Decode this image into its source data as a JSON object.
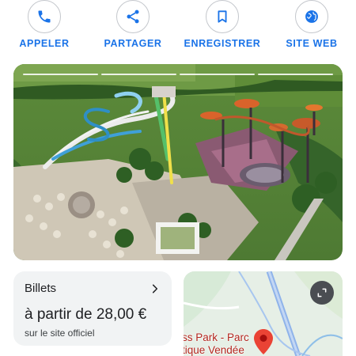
{
  "actions": [
    {
      "label": "APPELER",
      "icon": "phone-icon"
    },
    {
      "label": "PARTAGER",
      "icon": "share-icon"
    },
    {
      "label": "ENREGISTRER",
      "icon": "bookmark-icon"
    },
    {
      "label": "SITE WEB",
      "icon": "globe-icon"
    }
  ],
  "colors": {
    "accent": "#1a73e8",
    "pin": "#ea4335",
    "map_road": "#7aa8e8"
  },
  "hero": {
    "image": "aerial-water-park-photo",
    "story_segments": 4
  },
  "tickets": {
    "title": "Billets",
    "price": "à partir de 28,00 €",
    "source": "sur le site officiel"
  },
  "map": {
    "label_line1": "ss Park - Parc",
    "label_line2": "tique Vendée"
  }
}
